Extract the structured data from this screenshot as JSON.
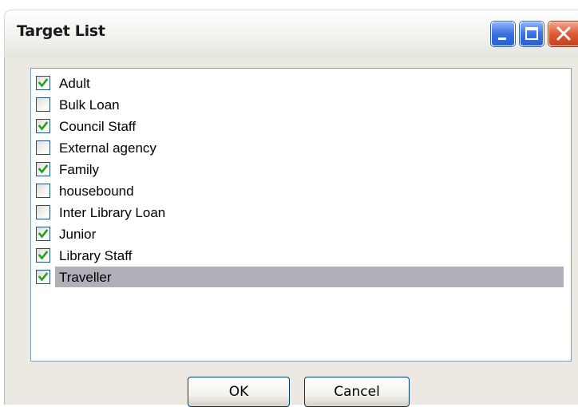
{
  "window": {
    "title": "Target List",
    "controls": [
      "minimize-icon",
      "maximize-icon",
      "close-icon"
    ],
    "accent_color": "#2a5fd0",
    "close_color": "#c8401e"
  },
  "list": {
    "items": [
      {
        "label": "Adult",
        "checked": true
      },
      {
        "label": "Bulk Loan",
        "checked": false
      },
      {
        "label": "Council Staff",
        "checked": true
      },
      {
        "label": "External agency",
        "checked": false
      },
      {
        "label": "Family",
        "checked": true
      },
      {
        "label": "housebound",
        "checked": false
      },
      {
        "label": "Inter Library Loan",
        "checked": false
      },
      {
        "label": "Junior",
        "checked": true
      },
      {
        "label": "Library Staff",
        "checked": true
      },
      {
        "label": "Traveller",
        "checked": true,
        "selected": true
      }
    ],
    "selection_color": "#b1b0b8",
    "check_color": "#21a121"
  },
  "buttons": {
    "ok_label": "OK",
    "cancel_label": "Cancel"
  }
}
